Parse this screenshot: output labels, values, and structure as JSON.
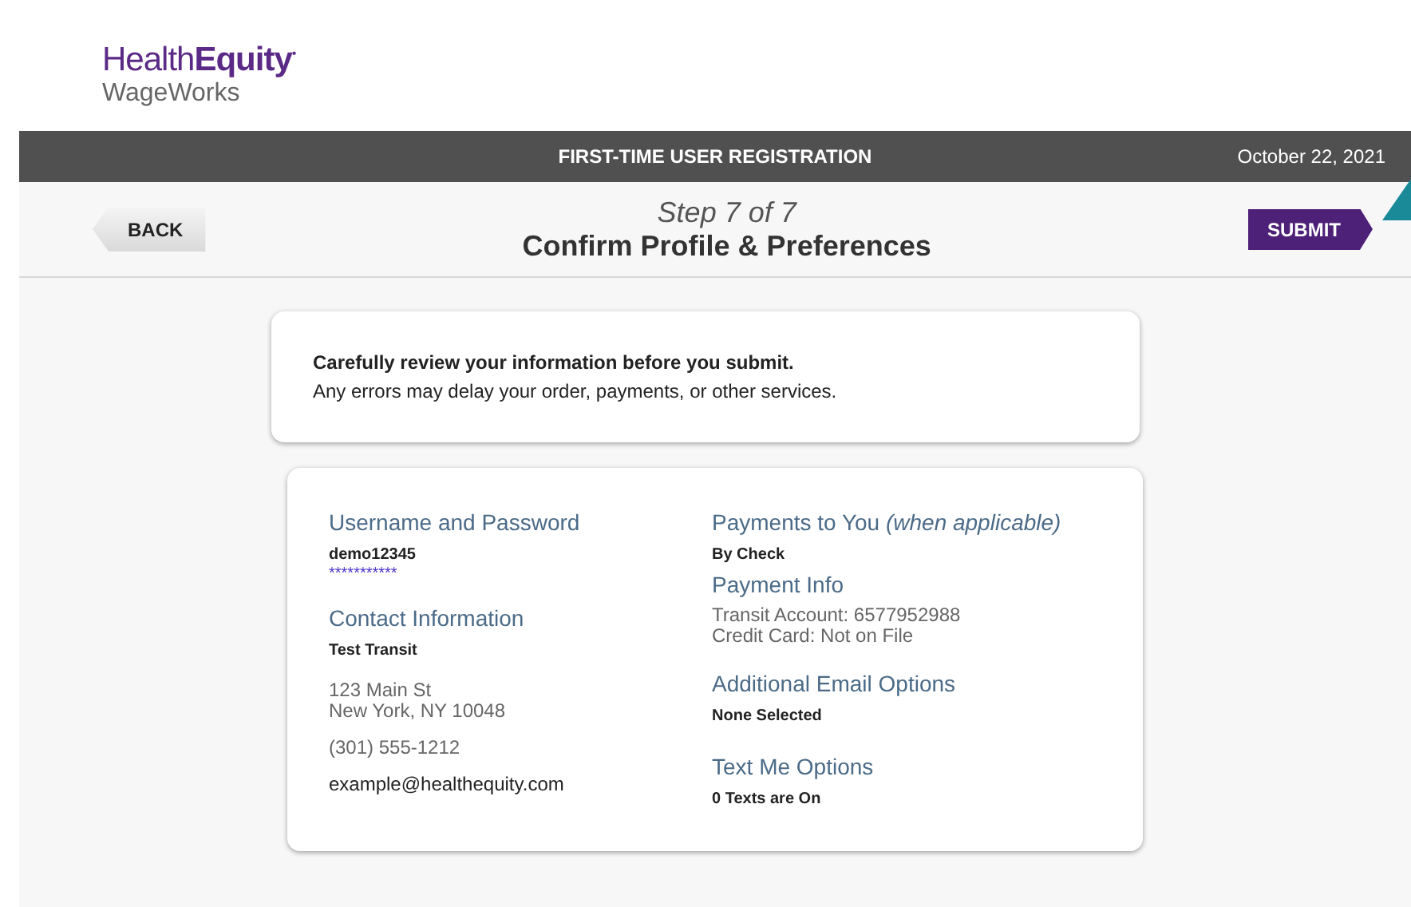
{
  "logo": {
    "brand_light": "Health",
    "brand_bold": "Equity",
    "trademark": "•",
    "sub": "WageWorks"
  },
  "title_bar": {
    "title": "FIRST-TIME USER REGISTRATION",
    "date": "October 22, 2021"
  },
  "step_bar": {
    "back": "BACK",
    "step": "Step 7 of 7",
    "heading": "Confirm Profile & Preferences",
    "submit": "SUBMIT"
  },
  "notice": {
    "lead": "Carefully review your information before you submit.",
    "text": "Any errors may delay your order, payments, or other services."
  },
  "columns": [
    [
      {
        "heading": "Username and Password",
        "blocks": [
          [
            {
              "kind": "bold",
              "text": "demo12345"
            },
            {
              "kind": "mask",
              "text": "***********"
            }
          ]
        ]
      },
      {
        "heading": "Contact Information",
        "blocks": [
          [
            {
              "kind": "bold",
              "text": "Test Transit"
            }
          ],
          [
            {
              "kind": "plain",
              "text": "123 Main St"
            },
            {
              "kind": "plain",
              "text": "New York, NY 10048"
            }
          ],
          [
            {
              "kind": "plain",
              "text": "(301) 555-1212"
            }
          ],
          [
            {
              "kind": "dark",
              "text": "example@healthequity.com"
            }
          ]
        ]
      }
    ],
    [
      {
        "heading": "Payments to You *(when applicable)*",
        "blocks": [
          [
            {
              "kind": "bold",
              "text": "By Check"
            },
            {
              "kind": "subheading",
              "text": "Payment Info"
            },
            {
              "kind": "plain",
              "text": "Transit Account: 6577952988"
            },
            {
              "kind": "plain",
              "text": "Credit Card: Not on File"
            }
          ]
        ]
      },
      {
        "heading": "Additional Email Options",
        "blocks": [
          [
            {
              "kind": "bold",
              "text": "None Selected"
            }
          ]
        ]
      },
      {
        "heading": "Text Me Options",
        "blocks": [
          [
            {
              "kind": "bold",
              "text": "0 Texts are On"
            }
          ]
        ]
      }
    ]
  ]
}
